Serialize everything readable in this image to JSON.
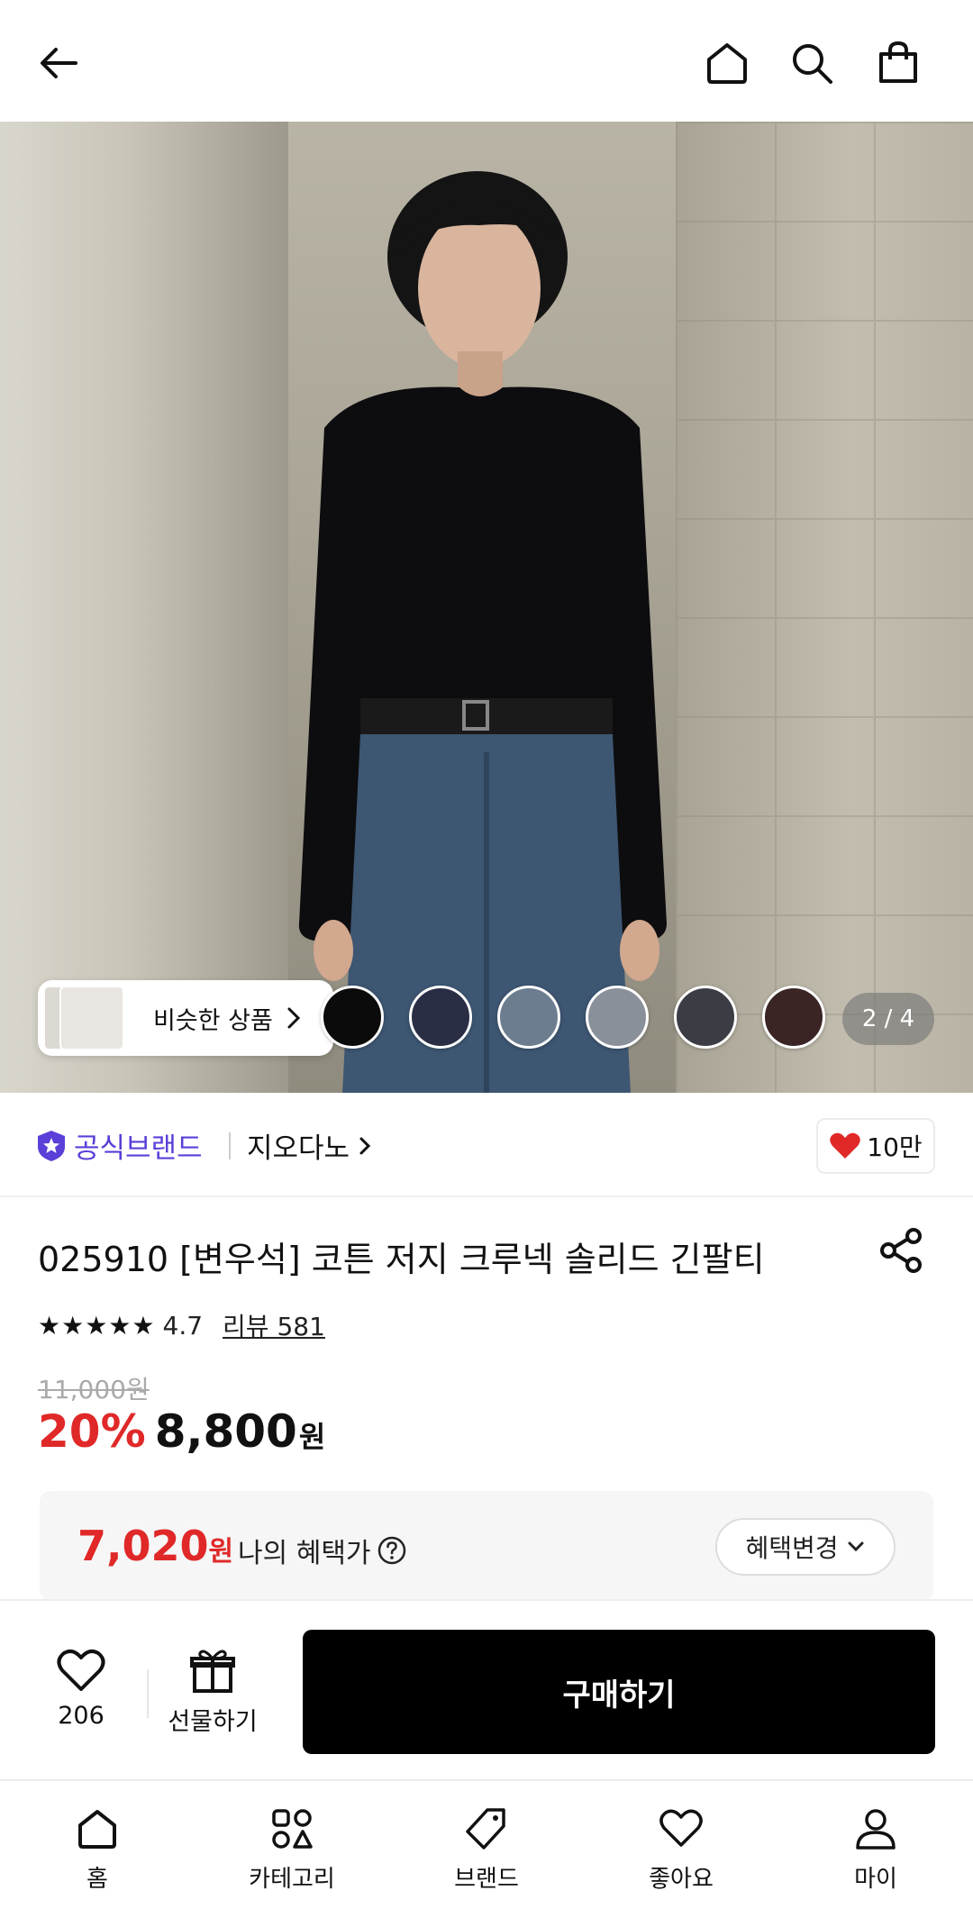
{
  "header": {
    "icons": [
      "arrow-left-icon",
      "home-icon",
      "search-icon",
      "shopping-bag-icon"
    ]
  },
  "hero": {
    "similar_label": "비슷한 상품",
    "swatch_colors": [
      "#0b0b0b",
      "#2a2e45",
      "#6c7d8f",
      "#8a9099",
      "#3b3c44",
      "#3a2424"
    ],
    "counter": "2 / 4"
  },
  "brand": {
    "official_label": "공식브랜드",
    "name": "지오다노",
    "like_count": "10만"
  },
  "product": {
    "title": "025910 [변우석] 코튼 저지 크루넥 솔리드 긴팔티",
    "stars": "★★★★★",
    "rating": "4.7",
    "reviews": "리뷰 581",
    "original_price": "11,000원",
    "discount": "20%",
    "price": "8,800",
    "currency": "원"
  },
  "benefit": {
    "price": "7,020",
    "unit": "원",
    "label": "나의 혜택가",
    "change_label": "혜택변경"
  },
  "purchase": {
    "wish_count": "206",
    "gift_label": "선물하기",
    "buy_label": "구매하기"
  },
  "nav": {
    "items": [
      {
        "label": "홈",
        "icon": "home-icon"
      },
      {
        "label": "카테고리",
        "icon": "category-icon"
      },
      {
        "label": "브랜드",
        "icon": "tag-icon"
      },
      {
        "label": "좋아요",
        "icon": "heart-icon"
      },
      {
        "label": "마이",
        "icon": "user-icon"
      }
    ]
  },
  "colors": {
    "accent_red": "#e02828",
    "brand_purple": "#5b3fd8",
    "buy_button": "#000000"
  }
}
